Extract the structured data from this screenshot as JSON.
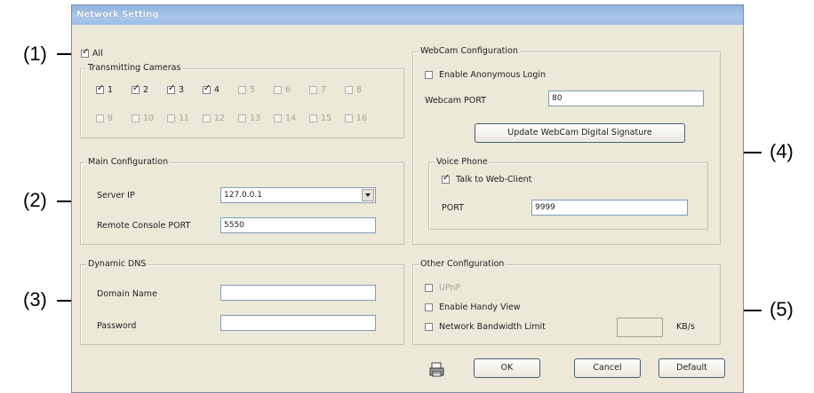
{
  "dialog": {
    "title": "Network Setting"
  },
  "callouts": [
    "(1)",
    "(2)",
    "(3)",
    "(4)",
    "(5)"
  ],
  "cameras": {
    "all_label": "All",
    "all_checked": true,
    "group_title": "Transmitting Cameras",
    "items": [
      {
        "label": "1",
        "checked": true,
        "enabled": true
      },
      {
        "label": "2",
        "checked": true,
        "enabled": true
      },
      {
        "label": "3",
        "checked": true,
        "enabled": true
      },
      {
        "label": "4",
        "checked": true,
        "enabled": true
      },
      {
        "label": "5",
        "checked": false,
        "enabled": false
      },
      {
        "label": "6",
        "checked": false,
        "enabled": false
      },
      {
        "label": "7",
        "checked": false,
        "enabled": false
      },
      {
        "label": "8",
        "checked": false,
        "enabled": false
      },
      {
        "label": "9",
        "checked": false,
        "enabled": false
      },
      {
        "label": "10",
        "checked": false,
        "enabled": false
      },
      {
        "label": "11",
        "checked": false,
        "enabled": false
      },
      {
        "label": "12",
        "checked": false,
        "enabled": false
      },
      {
        "label": "13",
        "checked": false,
        "enabled": false
      },
      {
        "label": "14",
        "checked": false,
        "enabled": false
      },
      {
        "label": "15",
        "checked": false,
        "enabled": false
      },
      {
        "label": "16",
        "checked": false,
        "enabled": false
      }
    ]
  },
  "main_config": {
    "group_title": "Main Configuration",
    "server_ip_label": "Server IP",
    "server_ip_value": "127.0.0.1",
    "remote_port_label": "Remote Console PORT",
    "remote_port_value": "5550"
  },
  "dynamic_dns": {
    "group_title": "Dynamic DNS",
    "domain_label": "Domain Name",
    "domain_value": "",
    "password_label": "Password",
    "password_value": ""
  },
  "webcam": {
    "group_title": "WebCam Configuration",
    "anon_label": "Enable Anonymous Login",
    "anon_checked": false,
    "port_label": "Webcam PORT",
    "port_value": "80",
    "update_button": "Update WebCam Digital Signature",
    "voice": {
      "group_title": "Voice Phone",
      "talk_label": "Talk to Web-Client",
      "talk_checked": true,
      "port_label": "PORT",
      "port_value": "9999"
    }
  },
  "other": {
    "group_title": "Other Configuration",
    "upnp_label": "UPnP",
    "upnp_checked": false,
    "handy_label": "Enable Handy View",
    "handy_checked": false,
    "bandwidth_label": "Network Bandwidth Limit",
    "bandwidth_checked": false,
    "bandwidth_value": "",
    "bandwidth_unit": "KB/s"
  },
  "footer": {
    "ok": "OK",
    "cancel": "Cancel",
    "default": "Default",
    "icon": "printer-icon"
  }
}
